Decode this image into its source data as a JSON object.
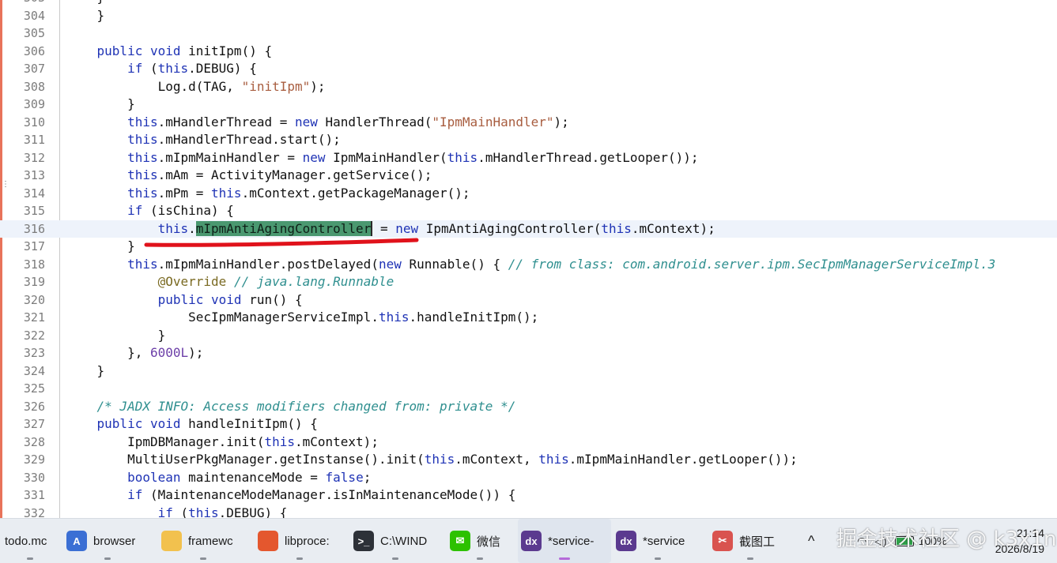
{
  "editor": {
    "lines": [
      {
        "n": "303",
        "segs": [
          {
            "t": "    }",
            "c": ""
          }
        ]
      },
      {
        "n": "304",
        "segs": [
          {
            "t": "    }",
            "c": ""
          }
        ]
      },
      {
        "n": "305",
        "segs": []
      },
      {
        "n": "306",
        "segs": [
          {
            "t": "    ",
            "c": ""
          },
          {
            "t": "public void",
            "c": "kw"
          },
          {
            "t": " initIpm() {",
            "c": ""
          }
        ]
      },
      {
        "n": "307",
        "segs": [
          {
            "t": "        ",
            "c": ""
          },
          {
            "t": "if",
            "c": "kw"
          },
          {
            "t": " (",
            "c": ""
          },
          {
            "t": "this",
            "c": "kw"
          },
          {
            "t": ".DEBUG) {",
            "c": ""
          }
        ]
      },
      {
        "n": "308",
        "segs": [
          {
            "t": "            Log.d(TAG, ",
            "c": ""
          },
          {
            "t": "\"initIpm\"",
            "c": "str"
          },
          {
            "t": ");",
            "c": ""
          }
        ]
      },
      {
        "n": "309",
        "segs": [
          {
            "t": "        }",
            "c": ""
          }
        ]
      },
      {
        "n": "310",
        "segs": [
          {
            "t": "        ",
            "c": ""
          },
          {
            "t": "this",
            "c": "kw"
          },
          {
            "t": ".mHandlerThread = ",
            "c": ""
          },
          {
            "t": "new",
            "c": "kw"
          },
          {
            "t": " HandlerThread(",
            "c": ""
          },
          {
            "t": "\"IpmMainHandler\"",
            "c": "str"
          },
          {
            "t": ");",
            "c": ""
          }
        ]
      },
      {
        "n": "311",
        "segs": [
          {
            "t": "        ",
            "c": ""
          },
          {
            "t": "this",
            "c": "kw"
          },
          {
            "t": ".mHandlerThread.start();",
            "c": ""
          }
        ]
      },
      {
        "n": "312",
        "segs": [
          {
            "t": "        ",
            "c": ""
          },
          {
            "t": "this",
            "c": "kw"
          },
          {
            "t": ".mIpmMainHandler = ",
            "c": ""
          },
          {
            "t": "new",
            "c": "kw"
          },
          {
            "t": " IpmMainHandler(",
            "c": ""
          },
          {
            "t": "this",
            "c": "kw"
          },
          {
            "t": ".mHandlerThread.getLooper());",
            "c": ""
          }
        ]
      },
      {
        "n": "313",
        "segs": [
          {
            "t": "        ",
            "c": ""
          },
          {
            "t": "this",
            "c": "kw"
          },
          {
            "t": ".mAm = ActivityManager.getService();",
            "c": ""
          }
        ]
      },
      {
        "n": "314",
        "segs": [
          {
            "t": "        ",
            "c": ""
          },
          {
            "t": "this",
            "c": "kw"
          },
          {
            "t": ".mPm = ",
            "c": ""
          },
          {
            "t": "this",
            "c": "kw"
          },
          {
            "t": ".mContext.getPackageManager();",
            "c": ""
          }
        ]
      },
      {
        "n": "315",
        "segs": [
          {
            "t": "        ",
            "c": ""
          },
          {
            "t": "if",
            "c": "kw"
          },
          {
            "t": " (isChina) {",
            "c": ""
          }
        ]
      },
      {
        "n": "316",
        "current": true,
        "segs": [
          {
            "t": "            ",
            "c": ""
          },
          {
            "t": "this",
            "c": "kw"
          },
          {
            "t": ".",
            "c": ""
          },
          {
            "t": "mIpmAntiAgingController",
            "c": "hl"
          },
          {
            "t": " = ",
            "c": "caret-after"
          },
          {
            "t": "new",
            "c": "kw"
          },
          {
            "t": " IpmAntiAgingController(",
            "c": ""
          },
          {
            "t": "this",
            "c": "kw"
          },
          {
            "t": ".mContext);",
            "c": ""
          }
        ]
      },
      {
        "n": "317",
        "segs": [
          {
            "t": "        }",
            "c": ""
          }
        ]
      },
      {
        "n": "318",
        "segs": [
          {
            "t": "        ",
            "c": ""
          },
          {
            "t": "this",
            "c": "kw"
          },
          {
            "t": ".mIpmMainHandler.postDelayed(",
            "c": ""
          },
          {
            "t": "new",
            "c": "kw"
          },
          {
            "t": " Runnable() { ",
            "c": ""
          },
          {
            "t": "// from class: com.android.server.ipm.SecIpmManagerServiceImpl.3",
            "c": "cmt"
          }
        ]
      },
      {
        "n": "319",
        "segs": [
          {
            "t": "            ",
            "c": ""
          },
          {
            "t": "@Override",
            "c": "anno"
          },
          {
            "t": " ",
            "c": ""
          },
          {
            "t": "// java.lang.Runnable",
            "c": "cmt"
          }
        ]
      },
      {
        "n": "320",
        "segs": [
          {
            "t": "            ",
            "c": ""
          },
          {
            "t": "public void",
            "c": "kw"
          },
          {
            "t": " run() {",
            "c": ""
          }
        ]
      },
      {
        "n": "321",
        "segs": [
          {
            "t": "                SecIpmManagerServiceImpl.",
            "c": ""
          },
          {
            "t": "this",
            "c": "kw"
          },
          {
            "t": ".handleInitIpm();",
            "c": ""
          }
        ]
      },
      {
        "n": "322",
        "segs": [
          {
            "t": "            }",
            "c": ""
          }
        ]
      },
      {
        "n": "323",
        "segs": [
          {
            "t": "        }, ",
            "c": ""
          },
          {
            "t": "6000L",
            "c": "num"
          },
          {
            "t": ");",
            "c": ""
          }
        ]
      },
      {
        "n": "324",
        "segs": [
          {
            "t": "    }",
            "c": ""
          }
        ]
      },
      {
        "n": "325",
        "segs": []
      },
      {
        "n": "326",
        "segs": [
          {
            "t": "    ",
            "c": ""
          },
          {
            "t": "/* JADX INFO: Access modifiers changed from: private */",
            "c": "cmt"
          }
        ]
      },
      {
        "n": "327",
        "segs": [
          {
            "t": "    ",
            "c": ""
          },
          {
            "t": "public void",
            "c": "kw"
          },
          {
            "t": " handleInitIpm() {",
            "c": ""
          }
        ]
      },
      {
        "n": "328",
        "segs": [
          {
            "t": "        IpmDBManager.init(",
            "c": ""
          },
          {
            "t": "this",
            "c": "kw"
          },
          {
            "t": ".mContext);",
            "c": ""
          }
        ]
      },
      {
        "n": "329",
        "segs": [
          {
            "t": "        MultiUserPkgManager.getInstanse().init(",
            "c": ""
          },
          {
            "t": "this",
            "c": "kw"
          },
          {
            "t": ".mContext, ",
            "c": ""
          },
          {
            "t": "this",
            "c": "kw"
          },
          {
            "t": ".mIpmMainHandler.getLooper());",
            "c": ""
          }
        ]
      },
      {
        "n": "330",
        "segs": [
          {
            "t": "        ",
            "c": ""
          },
          {
            "t": "boolean",
            "c": "kw"
          },
          {
            "t": " maintenanceMode = ",
            "c": ""
          },
          {
            "t": "false",
            "c": "kw"
          },
          {
            "t": ";",
            "c": ""
          }
        ]
      },
      {
        "n": "331",
        "segs": [
          {
            "t": "        ",
            "c": ""
          },
          {
            "t": "if",
            "c": "kw"
          },
          {
            "t": " (MaintenanceModeManager.isInMaintenanceMode()) {",
            "c": ""
          }
        ]
      },
      {
        "n": "332",
        "segs": [
          {
            "t": "            ",
            "c": ""
          },
          {
            "t": "if",
            "c": "kw"
          },
          {
            "t": " (",
            "c": ""
          },
          {
            "t": "this",
            "c": "kw"
          },
          {
            "t": ".DEBUG) {",
            "c": ""
          }
        ]
      }
    ],
    "annotation_color": "#e0121b"
  },
  "taskbar": {
    "items": [
      {
        "label": "todo.mc",
        "icon": "none",
        "icon_color": "",
        "left": 0
      },
      {
        "label": "browser",
        "icon": "browser-icon",
        "icon_color": "#3b6fd4",
        "glyph": "A"
      },
      {
        "label": "framewc",
        "icon": "folder-icon",
        "icon_color": "#f2c14e",
        "glyph": ""
      },
      {
        "label": "libproce:",
        "icon": "firefox-icon",
        "icon_color": "#e4572e",
        "glyph": ""
      },
      {
        "label": "C:\\WIND",
        "icon": "terminal-icon",
        "icon_color": "#2d3138",
        "glyph": ">_"
      },
      {
        "label": "微信",
        "icon": "wechat-icon",
        "icon_color": "#2dc100",
        "glyph": "✉"
      },
      {
        "label": "*service-",
        "icon": "jadx-icon",
        "icon_color": "#5b3a8f",
        "glyph": "dx",
        "active": true
      },
      {
        "label": "*service",
        "icon": "jadx-icon",
        "icon_color": "#5b3a8f",
        "glyph": "dx"
      },
      {
        "label": "截图工",
        "icon": "snip-icon",
        "icon_color": "#d9534f",
        "glyph": "✂"
      }
    ],
    "tray": {
      "chevron": "^",
      "battery_percent": "100%"
    },
    "clock": {
      "time": "21:14",
      "date": "2026/8/19"
    }
  },
  "watermark": {
    "text": "掘金技术社区 @ k3x1n"
  }
}
